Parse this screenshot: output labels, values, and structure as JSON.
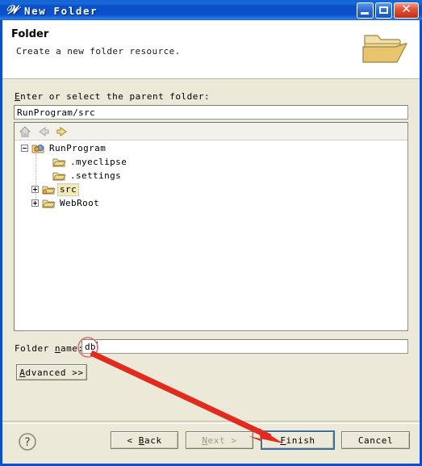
{
  "window": {
    "title": "New Folder",
    "icon": "eclipse-wizard-icon",
    "controls": {
      "minimize": "minimize-button",
      "maximize": "maximize-button",
      "close": "close-button"
    }
  },
  "header": {
    "title": "Folder",
    "subtitle": "Create a new folder resource.",
    "icon": "open-folder-icon"
  },
  "parent_folder": {
    "label_prefix": "E",
    "label_rest": "nter or select the parent folder:",
    "value": "RunProgram/src"
  },
  "tree_toolbar": {
    "home": "home-icon",
    "back": "back-arrow-icon",
    "forward": "forward-arrow-icon"
  },
  "tree": {
    "nodes": [
      {
        "label": "RunProgram",
        "depth": 0,
        "expander": "minus",
        "icon": "project-folder-icon",
        "selected": false
      },
      {
        "label": ".myeclipse",
        "depth": 1,
        "expander": "none",
        "icon": "folder-icon",
        "selected": false
      },
      {
        "label": ".settings",
        "depth": 1,
        "expander": "none",
        "icon": "folder-icon",
        "selected": false
      },
      {
        "label": "src",
        "depth": 1,
        "expander": "plus",
        "icon": "source-folder-icon",
        "selected": true
      },
      {
        "label": "WebRoot",
        "depth": 1,
        "expander": "plus",
        "icon": "folder-icon",
        "selected": false
      }
    ]
  },
  "folder_name": {
    "label_pre": "Folder ",
    "label_mn": "n",
    "label_post": "ame:",
    "value": "db"
  },
  "advanced_button": {
    "label_mn": "A",
    "label_rest": "dvanced >>"
  },
  "footer": {
    "help": "help-icon",
    "back": {
      "label": "< Back",
      "mn": "B",
      "enabled": true
    },
    "next": {
      "label": "Next >",
      "mn": "N",
      "enabled": false
    },
    "finish": {
      "label": "Finish",
      "mn": "F",
      "enabled": true,
      "default": true
    },
    "cancel": {
      "label": "Cancel",
      "mn": "",
      "enabled": true
    }
  },
  "annotations": {
    "ellipse_target": "folder-name-value",
    "arrow_from": "folder-name-value",
    "arrow_to": "finish-button",
    "color": "#E02B1E"
  },
  "colors": {
    "titlebar_blue": "#0A50C8",
    "dialog_bg": "#ECE9D8",
    "panel_white": "#FFFFFF",
    "selection": "#F5E9B8",
    "annotation_red": "#E02B1E"
  }
}
